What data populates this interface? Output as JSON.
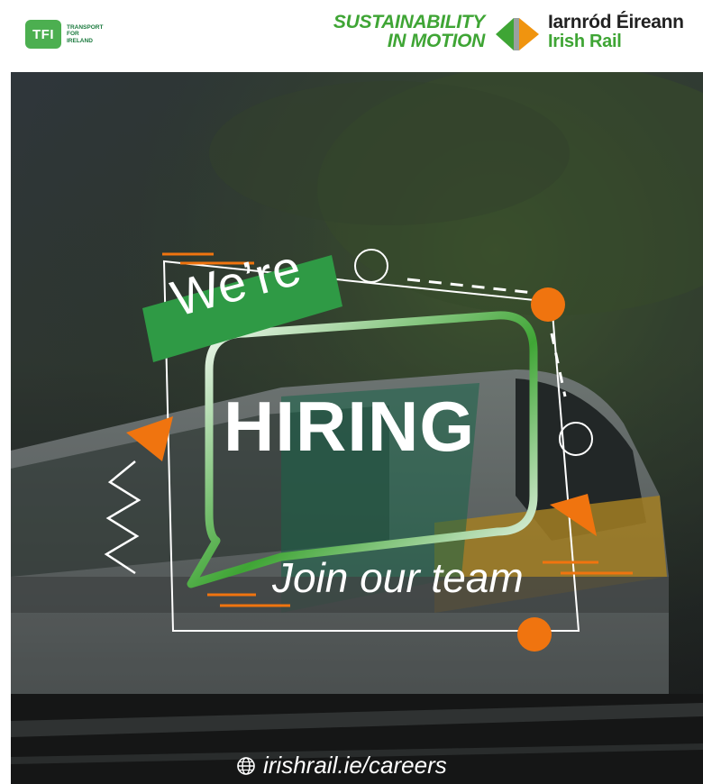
{
  "header": {
    "tfi_badge": "TFI",
    "tfi_lines": [
      "TRANSPORT",
      "FOR",
      "IRELAND"
    ],
    "sustainability_lines": [
      "SUSTAINABILITY",
      "IN MOTION"
    ],
    "ie_name": "Iarnród Éireann",
    "ie_sub": "Irish Rail"
  },
  "poster": {
    "were": "We’re",
    "hiring": "HIRING",
    "join": "Join our team",
    "url": "irishrail.ie/careers"
  },
  "colors": {
    "green": "#3fa535",
    "orange": "#f0740f",
    "white": "#ffffff"
  }
}
